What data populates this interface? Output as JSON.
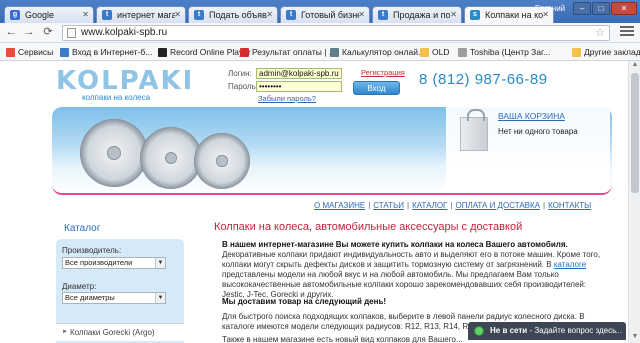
{
  "browser": {
    "tabs": [
      {
        "label": "Google",
        "favicon": "g",
        "color": "#3b6bd6",
        "active": false
      },
      {
        "label": "интернет магазин",
        "favicon": "t",
        "color": "#3a7ac9",
        "active": false
      },
      {
        "label": "Подать объявлен",
        "favicon": "t",
        "color": "#3a7ac9",
        "active": false
      },
      {
        "label": "Готовый бизнес",
        "favicon": "t",
        "color": "#3a7ac9",
        "active": false
      },
      {
        "label": "Продажа и покуп",
        "favicon": "t",
        "color": "#3a7ac9",
        "active": false
      },
      {
        "label": "Колпаки на коле",
        "favicon": "s",
        "color": "#2a8bcb",
        "active": true
      }
    ],
    "user": "Евгений",
    "window_buttons": {
      "minimize": "–",
      "maximize": "□",
      "close": "✕"
    },
    "url": "www.kolpaki-spb.ru",
    "bookmarks": [
      {
        "label": "Сервисы",
        "color": "#e74c3c"
      },
      {
        "label": "Вход в Интернет-б...",
        "color": "#3a7ac9"
      },
      {
        "label": "Record Online Player",
        "color": "#222222"
      },
      {
        "label": "Результат оплаты | ...",
        "color": "#d32f2f"
      },
      {
        "label": "Калькулятор онлай...",
        "color": "#607d8b"
      },
      {
        "label": "OLD",
        "color": "#f3c24a"
      },
      {
        "label": "Toshiba (Центр Заг...",
        "color": "#9e9e9e"
      },
      {
        "label": "Другие закладки",
        "color": "#f3c24a"
      }
    ]
  },
  "site": {
    "logo_word": "KOLPAKI",
    "logo_tagline": "колпаки на колеса",
    "login": {
      "login_label": "Логин:",
      "login_value": "admin@kolpaki-spb.ru",
      "password_label": "Пароль:",
      "password_value": "••••••••",
      "register_link": "Регистрация",
      "enter_button": "Вход",
      "forgot_link": "Забыли пароль?"
    },
    "phone": "8 (812) 987-66-89",
    "cart": {
      "title": "ВАША КОРЗИНА",
      "status": "Нет ни одного товара"
    },
    "nav": [
      "О МАГАЗИНЕ",
      "СТАТЬИ",
      "КАТАЛОГ",
      "ОПЛАТА И ДОСТАВКА",
      "КОНТАКТЫ"
    ],
    "sidebar": {
      "title": "Каталог",
      "manufacturer_label": "Производитель:",
      "manufacturer_value": "Все производители",
      "diameter_label": "Диаметр:",
      "diameter_value": "Все диаметры",
      "first_category": "Колпаки Gorecki (Argo)"
    },
    "content": {
      "heading": "Колпаки на колеса, автомобильные аксессуары с доставкой",
      "intro": "В нашем интернет-магазине Вы можете купить колпаки на колеса Вашего автомобиля.",
      "para1_a": "Декоративные колпаки придают индивидуальность авто и выделяют его в потоке машин. Кроме того, колпаки могут скрыть дефекты дисков и защитить тормозную систему от загрязнений. В ",
      "para1_link": "каталоге",
      "para1_b": " представлены модели на любой вкус и на любой автомобиль. Мы предлагаем Вам только высококачественные автомобильные колпаки хорошо зарекомендовавших себя производителей: Jestic, J-Tec, Gorecki и других.",
      "subheading": "Мы доставим товар на следующий день!",
      "para2": "Для быстрого поиска подходящих колпаков, выберите в левой панели радиус колесного диска. В каталоге имеются модели следующих радиусов: R12, R13, R14, R15, R16.",
      "para3": "Также в нашем магазине есть новый вид колпаков для Вашего..."
    },
    "chat": {
      "status": "Не в сети",
      "prompt": "- Задайте вопрос здесь",
      "more": "..."
    }
  }
}
